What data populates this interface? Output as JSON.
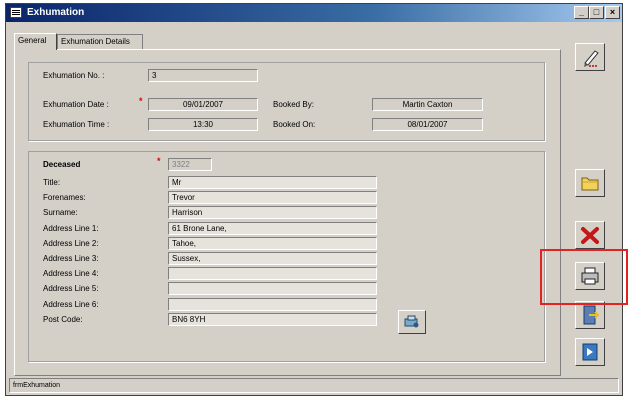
{
  "window": {
    "title": "Exhumation",
    "minimize": "_",
    "maximize": "□",
    "close": "×"
  },
  "tabs": [
    {
      "label": "General"
    },
    {
      "label": "Exhumation Details"
    }
  ],
  "booking": {
    "exhumation_no_label": "Exhumation No. :",
    "exhumation_no": "3",
    "exhumation_date_label": "Exhumation Date :",
    "exhumation_date": "09/01/2007",
    "exhumation_time_label": "Exhumation Time :",
    "exhumation_time": "13:30",
    "booked_by_label": "Booked By:",
    "booked_by": "Martin Caxton",
    "booked_on_label": "Booked On:",
    "booked_on": "08/01/2007",
    "required_marker": "*"
  },
  "deceased": {
    "heading": "Deceased",
    "id": "3322",
    "required_marker": "*",
    "rows": [
      {
        "label": "Title:",
        "value": "Mr"
      },
      {
        "label": "Forenames:",
        "value": "Trevor"
      },
      {
        "label": "Surname:",
        "value": "Harrison"
      },
      {
        "label": "Address Line 1:",
        "value": "61 Brone Lane,"
      },
      {
        "label": "Address Line 2:",
        "value": "Tahoe,"
      },
      {
        "label": "Address Line 3:",
        "value": "Sussex,"
      },
      {
        "label": "Address Line 4:",
        "value": ""
      },
      {
        "label": "Address Line 5:",
        "value": ""
      },
      {
        "label": "Address Line 6:",
        "value": ""
      },
      {
        "label": "Post Code:",
        "value": "BN6 8YH"
      }
    ]
  },
  "statusbar": {
    "text": "frmExhumation"
  },
  "icons": {
    "edit": "edit-pencil-icon",
    "open": "folder-icon",
    "delete": "delete-x-icon",
    "print": "printer-icon",
    "exit": "exit-door-icon",
    "help": "help-book-icon",
    "lookup": "lookup-icon"
  },
  "colors": {
    "highlight": "#e32222",
    "required": "#e00000",
    "titlebar": "#0a246a"
  }
}
